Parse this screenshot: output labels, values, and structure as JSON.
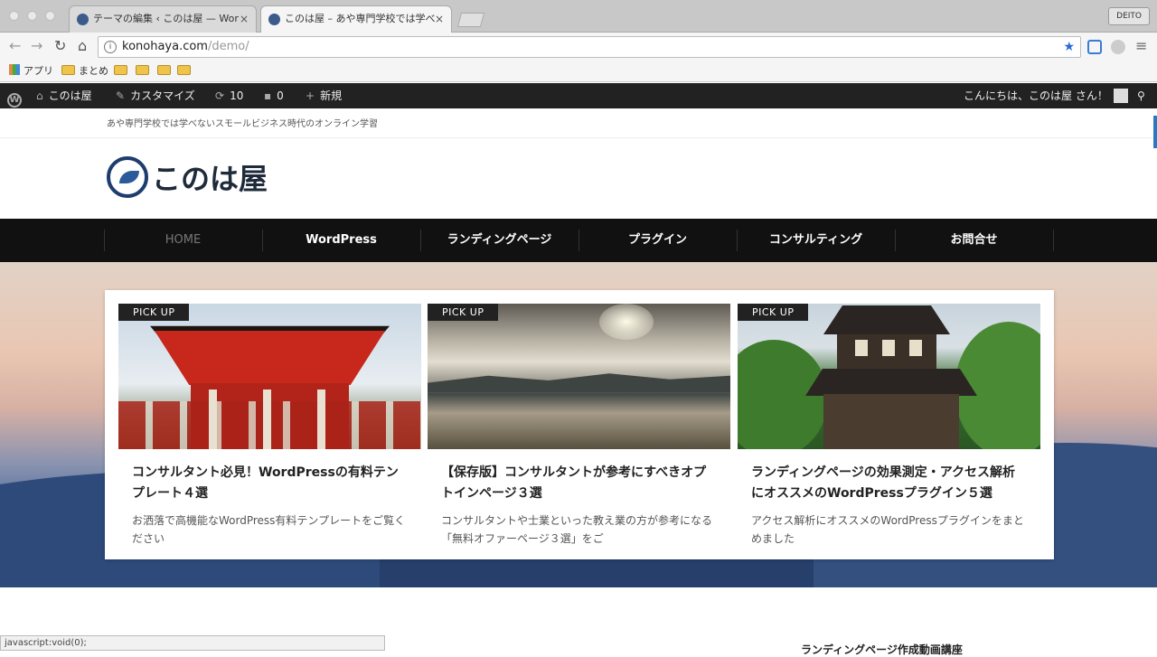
{
  "browser": {
    "tabs": [
      {
        "title": "テーマの編集 ‹ このは屋 — Wor"
      },
      {
        "title": "このは屋 – あや専門学校では学べ"
      }
    ],
    "profile": "DEITO",
    "url_host": "konohaya.com",
    "url_path": "/demo/",
    "bookmarks": {
      "apps": "アプリ",
      "matome": "まとめ"
    },
    "status_text": "javascript:void(0);"
  },
  "adminbar": {
    "site_name": "このは屋",
    "customize": "カスタマイズ",
    "updates": "10",
    "comments": "0",
    "new": "新規",
    "greeting": "こんにちは、このは屋 さん！"
  },
  "site": {
    "tagline": "あや専門学校では学べないスモールビジネス時代のオンライン学習",
    "logo_text": "このは屋",
    "nav": [
      "HOME",
      "WordPress",
      "ランディングページ",
      "プラグイン",
      "コンサルティング",
      "お問合せ"
    ]
  },
  "pickups": [
    {
      "badge": "PICK UP",
      "title": "コンサルタント必見！WordPressの有料テンプレート４選",
      "desc": "お洒落で高機能なWordPress有料テンプレートをご覧ください"
    },
    {
      "badge": "PICK UP",
      "title": "【保存版】コンサルタントが参考にすべきオプトインページ３選",
      "desc": "コンサルタントや士業といった教え業の方が参考になる「無料オファーページ３選」をご"
    },
    {
      "badge": "PICK UP",
      "title": "ランディングページの効果測定・アクセス解析にオススメのWordPressプラグイン５選",
      "desc": "アクセス解析にオススメのWordPressプラグインをまとめました"
    }
  ],
  "sidebar": {
    "heading": "ランディングページ作成動画講座"
  }
}
